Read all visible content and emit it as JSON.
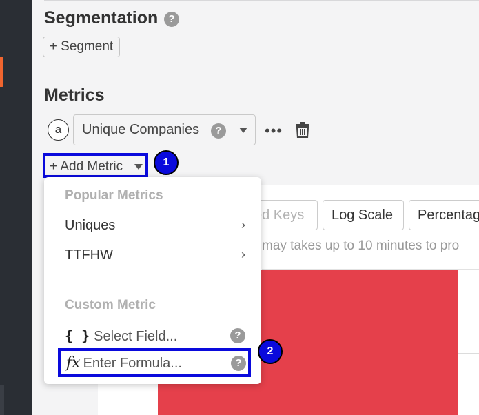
{
  "segmentation": {
    "title": "Segmentation",
    "help": "?",
    "add_button": "+ Segment"
  },
  "metrics": {
    "title": "Metrics",
    "letter": "a",
    "selected_metric": "Unique Companies",
    "help": "?",
    "more": "•••",
    "add_button": "+ Add Metric"
  },
  "badges": {
    "one": "1",
    "two": "2"
  },
  "chart_controls": {
    "ghost_label": "ed Keys",
    "log_scale": "Log Scale",
    "percentage": "Percentag",
    "notice": "may takes up to 10 minutes to pro"
  },
  "dropdown": {
    "popular_header": "Popular Metrics",
    "popular_items": [
      {
        "label": "Uniques",
        "chevron": "›"
      },
      {
        "label": "TTFHW",
        "chevron": "›"
      }
    ],
    "custom_header": "Custom Metric",
    "select_field": {
      "icon": "{ }",
      "label": "Select Field...",
      "help": "?"
    },
    "enter_formula": {
      "icon": "fx",
      "label": "Enter Formula...",
      "help": "?"
    }
  },
  "colors": {
    "highlight": "#0a0adc",
    "bar": "#e5404b",
    "accent": "#f0652f"
  }
}
